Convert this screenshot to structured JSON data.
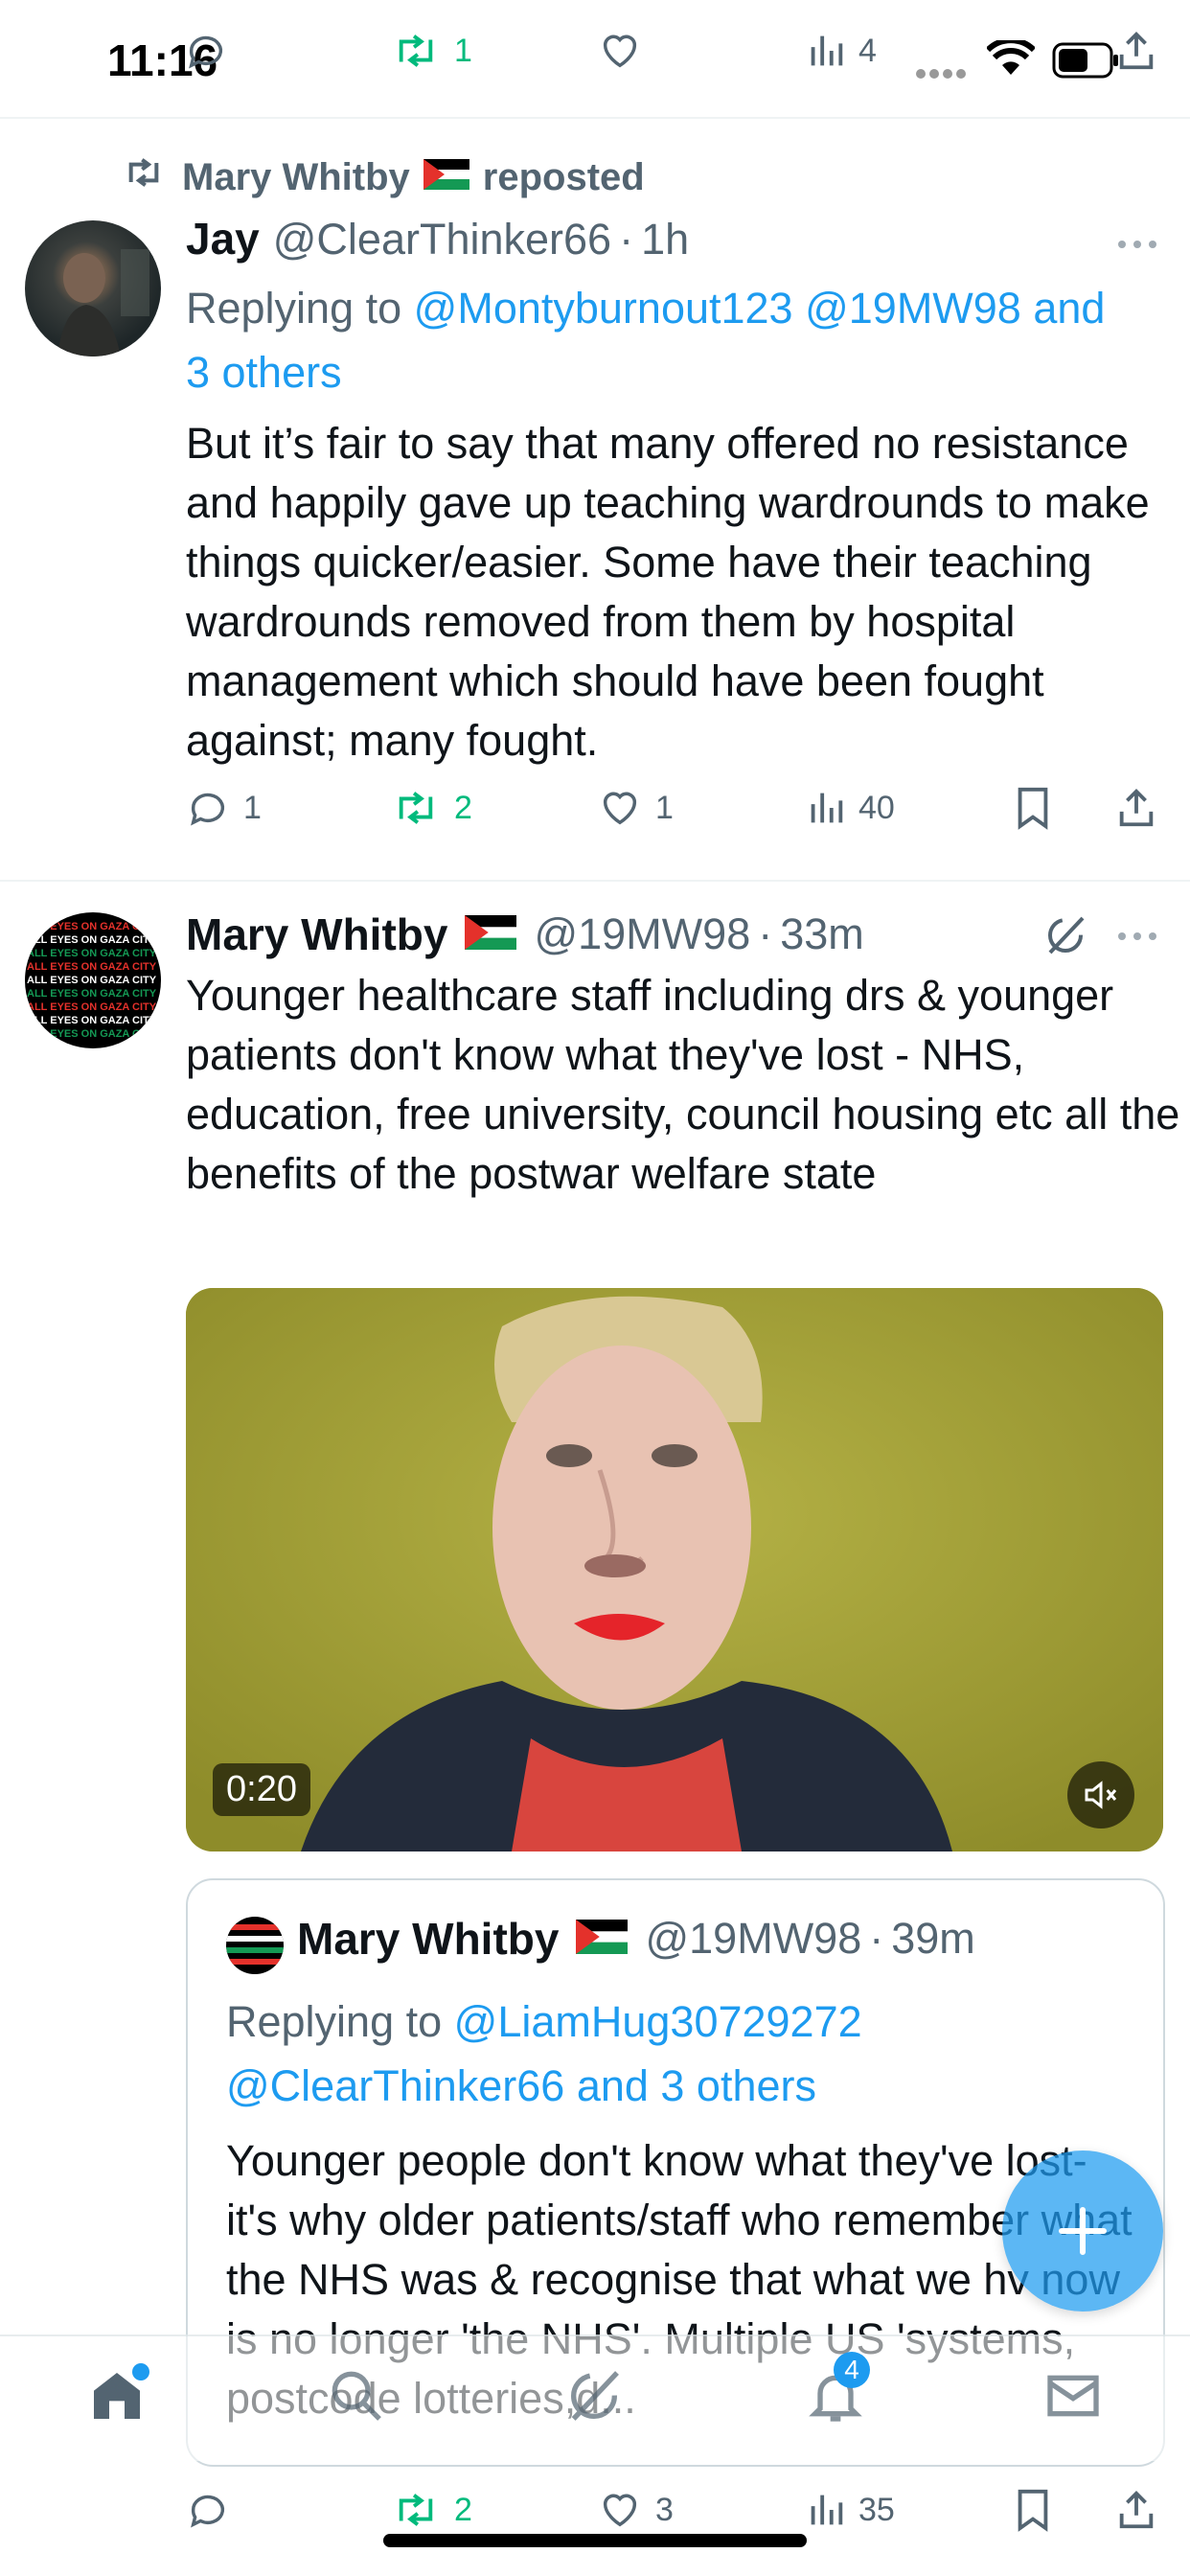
{
  "status_bar": {
    "time": "11:16"
  },
  "top_partial_actions": {
    "retweets": "1",
    "views": "4"
  },
  "repost_banner": {
    "user": "Mary Whitby",
    "suffix": "reposted"
  },
  "tweet1": {
    "name": "Jay",
    "handle": "@ClearThinker66",
    "time": "1h",
    "replying_label": "Replying to",
    "replying_users": "@Montyburnout123 @19MW98 and",
    "replying_users_2": "3 others",
    "text": "But it’s fair to say that many offered no resistance and happily gave up teaching wardrounds to make things quicker/easier. Some have their teaching wardrounds removed from them by hospital management which should have been fought against; many fought.",
    "replies": "1",
    "retweets": "2",
    "likes": "1",
    "views": "40"
  },
  "tweet2": {
    "name": "Mary Whitby",
    "handle": "@19MW98",
    "time": "33m",
    "text": "Younger healthcare staff including drs & younger patients don't know what they've lost - NHS, education, free university, council housing etc all the benefits of the postwar welfare state",
    "video_duration": "0:20",
    "quoted": {
      "name": "Mary Whitby",
      "handle": "@19MW98",
      "time": "39m",
      "replying_label": "Replying to",
      "replying_users": "@LiamHug30729272",
      "replying_users_2": "@ClearThinker66 and 3 others",
      "text": "Younger people don't know what they've lost- it's why older patients/staff who remember what the NHS was & recognise that what we hv now is no longer 'the NHS'. Multiple US 'systems, postcode lotteries,d..."
    },
    "replies": "",
    "retweets": "2",
    "likes": "3",
    "views": "35"
  },
  "avatar_text": "ALL EYES ON GAZA CITY",
  "bottom_nav": {
    "notifications_badge": "4"
  },
  "colors": {
    "accent": "#1d9bf0",
    "retweet_green": "#00ba7c",
    "muted": "#536471"
  }
}
